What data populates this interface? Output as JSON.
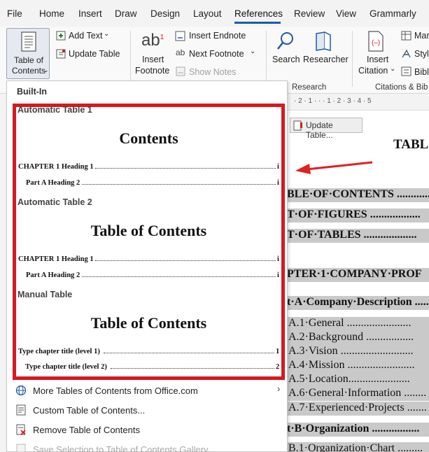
{
  "menu": {
    "tabs": [
      "File",
      "Home",
      "Insert",
      "Draw",
      "Design",
      "Layout",
      "References",
      "Review",
      "View",
      "Grammarly"
    ],
    "active": "References"
  },
  "ribbon": {
    "toc_button": {
      "line1": "Table of",
      "line2": "Contents"
    },
    "add_text": "Add Text",
    "update_table": "Update Table",
    "insert_footnote": {
      "line1": "Insert",
      "line2": "Footnote"
    },
    "insert_endnote": "Insert Endnote",
    "next_footnote": "Next Footnote",
    "show_notes": "Show Notes",
    "search": "Search",
    "researcher": "Researcher",
    "research_group": "Research",
    "insert_citation": {
      "line1": "Insert",
      "line2": "Citation"
    },
    "manage_sources": "Mar",
    "style": "Style",
    "bibliography": "Bibl",
    "citations_group": "Citations & Bib"
  },
  "dropdown": {
    "header": "Built-In",
    "gallery": [
      {
        "name": "Automatic Table 1",
        "heading": "Contents",
        "rows": [
          {
            "text": "CHAPTER 1 Heading 1",
            "page": "i"
          },
          {
            "text": "Part A Heading 2",
            "page": "i"
          }
        ]
      },
      {
        "name": "Automatic Table 2",
        "heading": "Table of Contents",
        "rows": [
          {
            "text": "CHAPTER 1 Heading 1",
            "page": "i"
          },
          {
            "text": "Part A Heading 2",
            "page": "i"
          }
        ]
      },
      {
        "name": "Manual Table",
        "heading": "Table of Contents",
        "rows": [
          {
            "text": "Type chapter title (level 1)",
            "page": "1"
          },
          {
            "text": "Type chapter title (level 2)",
            "page": "2"
          }
        ]
      }
    ],
    "items": [
      {
        "label": "More Tables of Contents from Office.com"
      },
      {
        "label": "Custom Table of Contents..."
      },
      {
        "label": "Remove Table of Contents"
      },
      {
        "label": "Save Selection to Table of Contents Gallery..."
      }
    ]
  },
  "document": {
    "update_tab": "Update Table...",
    "title": "TABL",
    "lines": [
      "BLE·OF·CONTENTS ...............",
      "T·OF·FIGURES ..................",
      "T·OF·TABLES ...................",
      "PTER·1·COMPANY·PROF",
      "t·A·Company·Description ........",
      "A.1·General .......................",
      "A.2·Background .................",
      "A.3·Vision ..........................",
      "A.4·Mission ........................",
      "A.5·Location......................",
      "A.6·General·Information ........",
      "A.7·Experienced·Projects .......",
      "t·B·Organization .................",
      "B.1·Organization·Chart ........."
    ]
  },
  "colors": {
    "highlight_box": "#d71920",
    "accent": "#1f5aa8",
    "doc_highlight": "#c9c9c9"
  }
}
